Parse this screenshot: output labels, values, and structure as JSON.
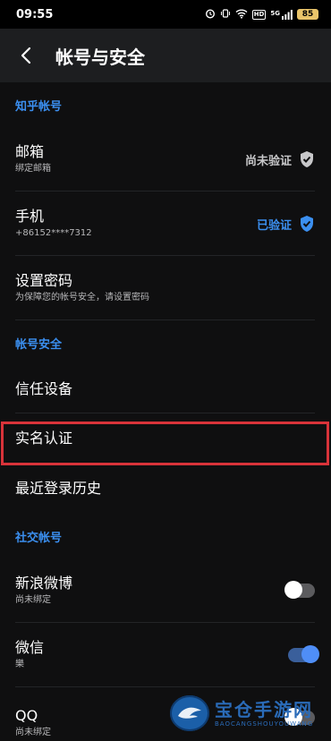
{
  "status_bar": {
    "time": "09:55",
    "network": "5G",
    "hd": "HD",
    "battery": "85"
  },
  "header": {
    "title": "帐号与安全"
  },
  "sections": {
    "zhihu_account": {
      "header": "知乎帐号",
      "email": {
        "label": "邮箱",
        "sub": "绑定邮箱",
        "status": "尚未验证"
      },
      "phone": {
        "label": "手机",
        "sub": "+86152****7312",
        "status": "已验证"
      },
      "password": {
        "label": "设置密码",
        "sub": "为保障您的帐号安全，请设置密码"
      }
    },
    "account_security": {
      "header": "帐号安全",
      "trusted_devices": {
        "label": "信任设备"
      },
      "real_name": {
        "label": "实名认证"
      },
      "login_history": {
        "label": "最近登录历史"
      }
    },
    "social_accounts": {
      "header": "社交帐号",
      "weibo": {
        "label": "新浪微博",
        "sub": "尚未绑定",
        "bound": false
      },
      "wechat": {
        "label": "微信",
        "sub": "樂",
        "bound": true
      },
      "qq": {
        "label": "QQ",
        "sub": "尚未绑定",
        "bound": false
      }
    }
  },
  "watermark": {
    "text_cn": "宝仓手游网",
    "text_en": "BAOCANGSHOUYOUWANG"
  },
  "colors": {
    "accent": "#3b8ff0",
    "highlight_border": "#d9333a",
    "background": "#0f0f10",
    "header_bg": "#1d1e20"
  }
}
